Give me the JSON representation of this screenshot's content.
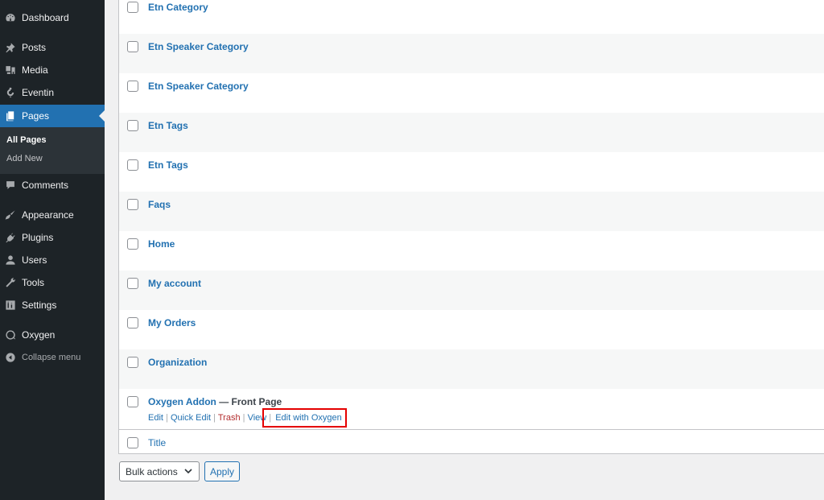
{
  "sidebar": {
    "items": [
      {
        "label": "Dashboard",
        "icon": "dashboard-icon"
      },
      {
        "label": "Posts",
        "icon": "pin-icon"
      },
      {
        "label": "Media",
        "icon": "media-icon"
      },
      {
        "label": "Eventin",
        "icon": "eventin-icon"
      },
      {
        "label": "Pages",
        "icon": "pages-icon",
        "active": true
      },
      {
        "label": "Comments",
        "icon": "comment-icon"
      },
      {
        "label": "Appearance",
        "icon": "brush-icon"
      },
      {
        "label": "Plugins",
        "icon": "plug-icon"
      },
      {
        "label": "Users",
        "icon": "user-icon"
      },
      {
        "label": "Tools",
        "icon": "wrench-icon"
      },
      {
        "label": "Settings",
        "icon": "settings-icon"
      },
      {
        "label": "Oxygen",
        "icon": "oxygen-icon"
      },
      {
        "label": "Collapse menu",
        "icon": "collapse-icon"
      }
    ],
    "submenu": [
      {
        "label": "All Pages",
        "current": true
      },
      {
        "label": "Add New"
      }
    ]
  },
  "table": {
    "rows": [
      {
        "title": "Etn Category"
      },
      {
        "title": "Etn Speaker Category"
      },
      {
        "title": "Etn Speaker Category"
      },
      {
        "title": "Etn Tags"
      },
      {
        "title": "Etn Tags"
      },
      {
        "title": "Faqs"
      },
      {
        "title": "Home"
      },
      {
        "title": "My account"
      },
      {
        "title": "My Orders"
      },
      {
        "title": "Organization"
      },
      {
        "title": "Oxygen Addon",
        "suffix": " — Front Page"
      }
    ],
    "row_actions": {
      "edit": "Edit",
      "quick_edit": "Quick Edit",
      "trash": "Trash",
      "view": "View",
      "edit_with_oxygen": "Edit with Oxygen",
      "separator": " | "
    },
    "footer_column": "Title"
  },
  "bulk_actions": {
    "selected": "Bulk actions",
    "apply_label": "Apply"
  },
  "colors": {
    "accent": "#2271b1",
    "sidebar_bg": "#1d2327",
    "highlight_box": "#e50000",
    "trash": "#b32d2e"
  }
}
